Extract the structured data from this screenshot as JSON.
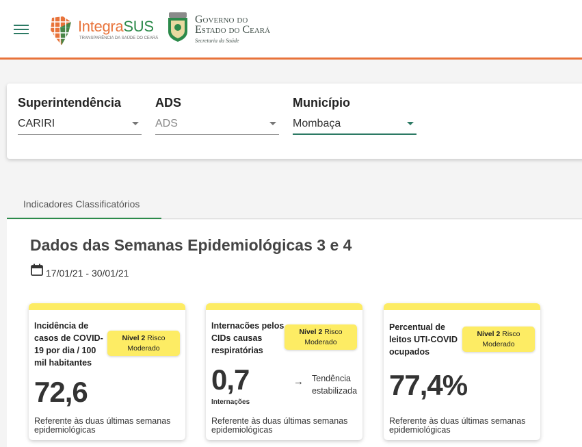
{
  "header": {
    "logo_part1": "Integra",
    "logo_part2": "SUS",
    "logo_tagline": "TRANSPARÊNCIA DA SAÚDE DO CEARÁ",
    "gov_line1": "Governo do",
    "gov_line2": "Estado do Ceará",
    "gov_line3": "Secretaria da Saúde"
  },
  "filters": {
    "superintendencia": {
      "label": "Superintendência",
      "value": "CARIRI"
    },
    "ads": {
      "label": "ADS",
      "value": "ADS"
    },
    "municipio": {
      "label": "Município",
      "value": "Mombaça"
    }
  },
  "tabs": [
    {
      "label": "Indicadores Classificatórios"
    }
  ],
  "section": {
    "title": "Dados das Semanas Epidemiológicas 3 e 4",
    "date_range": "17/01/21 - 30/01/21"
  },
  "cards": [
    {
      "title": "Incidência de casos de COVID-19 por dia / 100 mil habitantes",
      "badge_level": "Nível 2",
      "badge_rest": " Risco Moderado",
      "value": "72,6",
      "reference": "Referente às duas últimas semanas epidemiológicas"
    },
    {
      "title": "Internacões pelos CIDs causas respiratórias",
      "badge_level": "Nível 2",
      "badge_rest": " Risco Moderado",
      "value": "0,7",
      "unit": "Internações",
      "trend": "Tendência estabilizada",
      "reference": "Referente às duas últimas semanas epidemiológicas"
    },
    {
      "title": "Percentual de leitos UTI-COVID ocupados",
      "badge_level": "Nível 2",
      "badge_rest": " Risco Moderado",
      "value": "77,4%",
      "reference": "Referente às duas últimas semanas epidemiológicas"
    }
  ],
  "colors": {
    "accent_orange": "#e8733a",
    "accent_green": "#2c8a4a",
    "risk_yellow": "#fdec64"
  },
  "icons": [
    "menu-icon",
    "calendar-icon",
    "chevron-down-icon",
    "arrow-right-icon"
  ]
}
